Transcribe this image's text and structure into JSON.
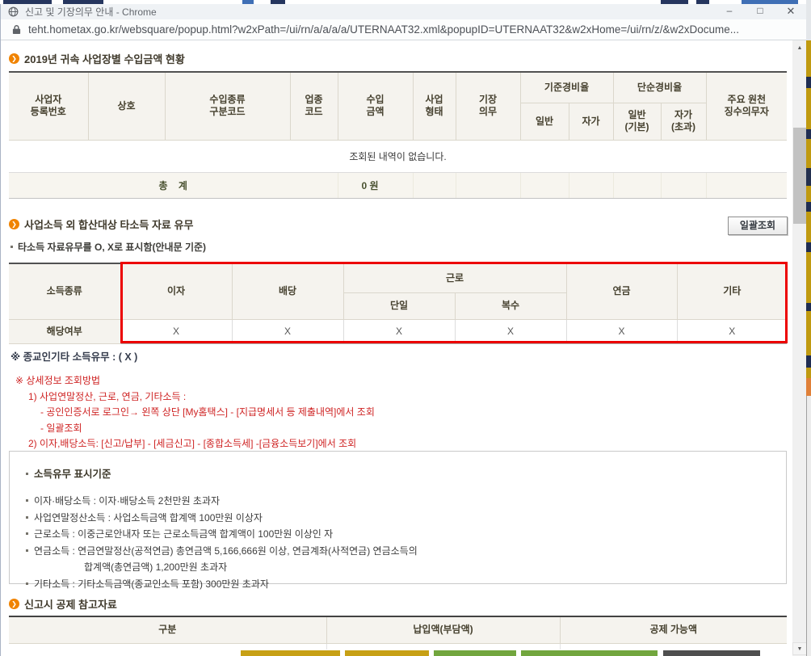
{
  "window": {
    "title": "신고 및 기장의무 안내 - Chrome",
    "url": "teht.hometax.go.kr/websquare/popup.html?w2xPath=/ui/rn/a/a/a/a/UTERNAAT32.xml&popupID=UTERNAAT32&w2xHome=/ui/rn/z/&w2xDocume..."
  },
  "icons": {
    "minimize": "–",
    "maximize": "□",
    "close": "✕",
    "scroll_up": "▲",
    "scroll_down": "▼",
    "bullet": "❯"
  },
  "colors": {
    "accent_orange": "#f08300",
    "red_text": "#cf2424",
    "highlight_border": "#ec0000",
    "table_header_bg": "#f5f3ee",
    "gold_button": "#c7a015",
    "green_button": "#72a63e",
    "dark_button": "#4f4f4f"
  },
  "section1": {
    "title": "2019년 귀속 사업장별 수입금액 현황",
    "table": {
      "col_biz_no": "사업자\n등록번호",
      "col_trade_name": "상호",
      "col_income_type_code": "수입종류\n구분코드",
      "col_industry_code": "업종\n코드",
      "col_income_amount": "수입\n금액",
      "col_business_form": "사업\n형태",
      "col_bookkeeping_duty": "기장\n의무",
      "grp_standard_rate": "기준경비율",
      "grp_simple_rate": "단순경비율",
      "sub_standard_general": "일반",
      "sub_standard_self": "자가",
      "sub_simple_general": "일반\n(기본)",
      "sub_simple_self": "자가\n(초과)",
      "col_withholding_agent": "주요 원천\n징수의무자",
      "empty_message": "조회된 내역이 없습니다.",
      "total_label": "총    계",
      "total_value": "0 원"
    }
  },
  "section2": {
    "title": "사업소득 외 합산대상 타소득 자료 유무",
    "batch_button": "일괄조회",
    "note": "타소득 자료유무를 O, X로 표시함(안내문 기준)",
    "table": {
      "col_income_kind": "소득종류",
      "col_interest": "이자",
      "col_dividend": "배당",
      "col_labor": "근로",
      "col_labor_single": "단일",
      "col_labor_multiple": "복수",
      "col_pension": "연금",
      "col_other": "기타",
      "row_applicable": "해당여부",
      "values": [
        "X",
        "X",
        "X",
        "X",
        "X",
        "X"
      ]
    },
    "religious_note": "※ 종교인기타 소득유무 : ( X )",
    "detail": {
      "heading": "※  상세정보 조회방법",
      "lines": [
        "1) 사업연말정산, 근로, 연금, 기타소득 :",
        "- 공인인증서로 로그인→ 왼쪽 상단 [My홈택스] - [지급명세서 등 제출내역]에서 조회",
        "- 일괄조회",
        "2) 이자,배당소득: [신고/납부] - [세금신고] - [종합소득세] -[금융소득보기]에서 조회"
      ]
    },
    "criteria": {
      "title": "소득유무 표시기준",
      "items": [
        "이자·배당소득 : 이자·배당소득 2천만원 초과자",
        "사업연말정산소득 : 사업소득금액 합계액 100만원 이상자",
        "근로소득 : 이중근로안내자 또는 근로소득금액 합계액이 100만원 이상인 자",
        "연금소득 : 연금연말정산(공적연금) 총연금액 5,166,666원 이상, 연금계좌(사적연금) 연금소득의",
        "합계액(총연금액) 1,200만원 초과자",
        "기타소득 : 기타소득금액(종교인소득 포함) 300만원 초과자"
      ]
    }
  },
  "section3": {
    "title": "신고시 공제 참고자료",
    "cols": [
      "구분",
      "납입액(부담액)",
      "공제 가능액"
    ]
  }
}
